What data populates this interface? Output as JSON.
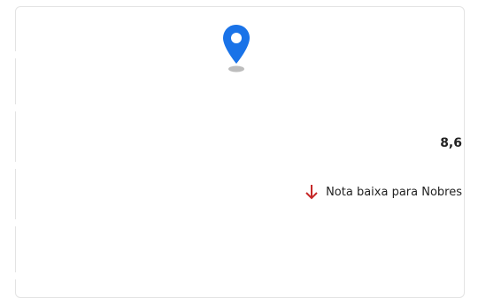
{
  "score": {
    "value": "8,6"
  },
  "note": {
    "text": "Nota baixa para Nobres"
  },
  "icons": {
    "location": "map-pin-icon",
    "trend": "arrow-down-icon"
  },
  "colors": {
    "pin": "#1a73e8",
    "arrow": "#c62828"
  }
}
